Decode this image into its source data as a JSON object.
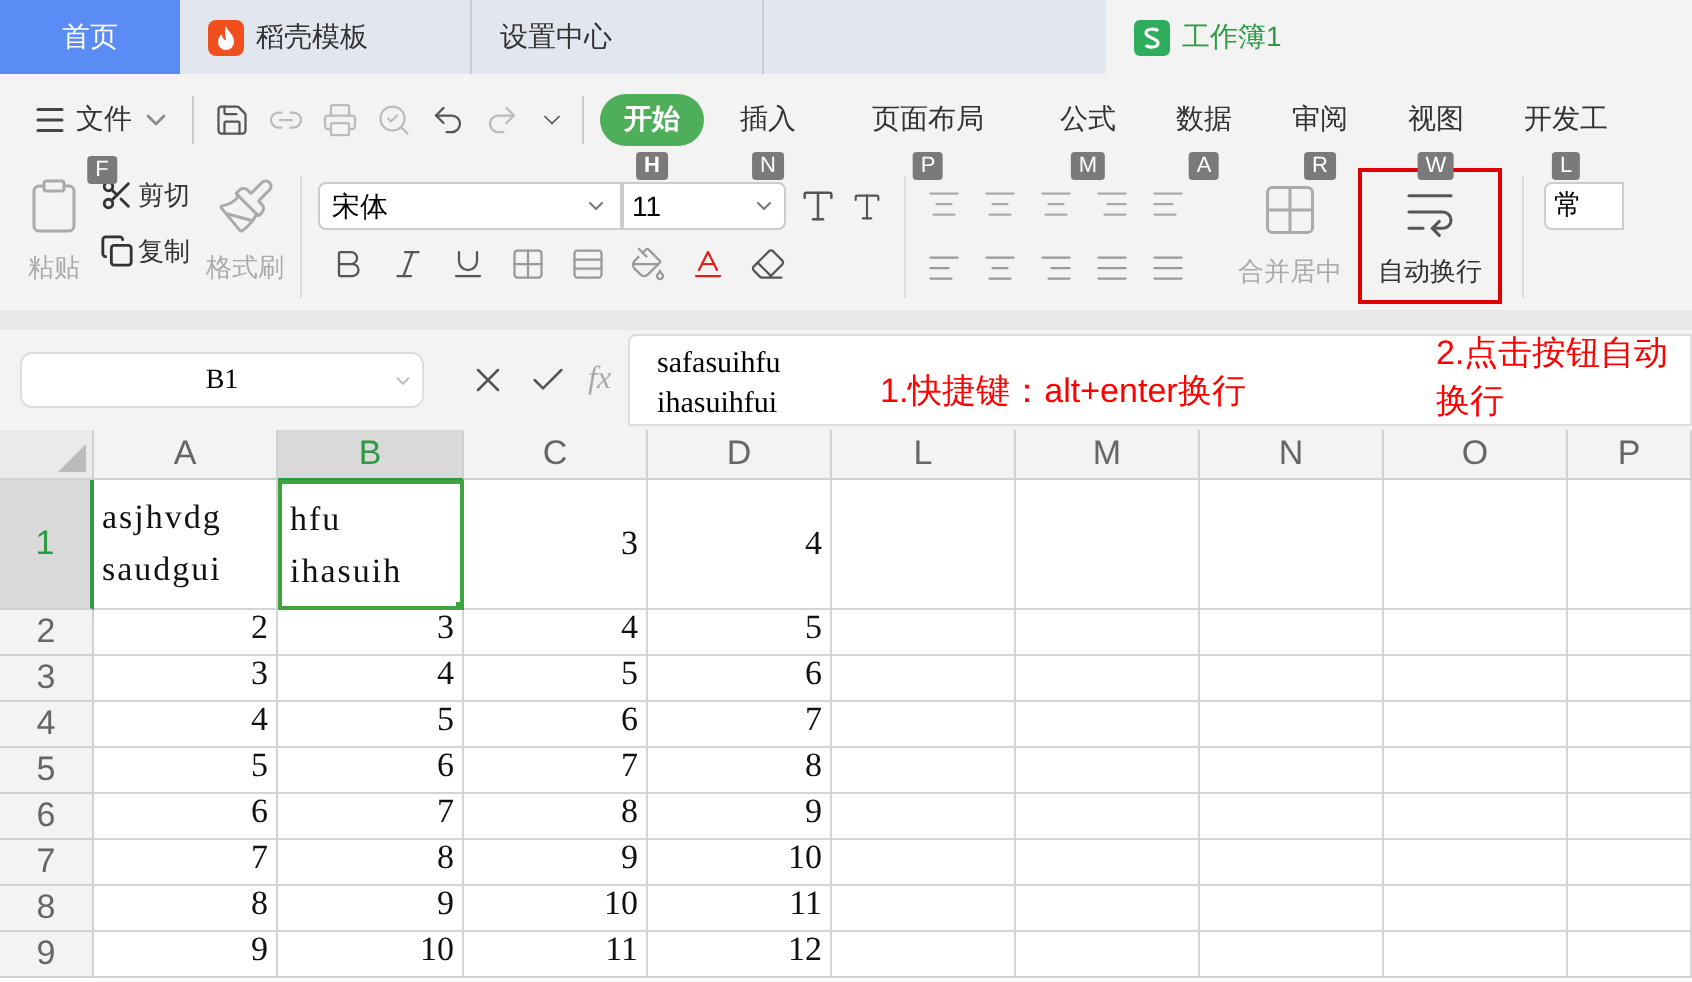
{
  "tabs": [
    {
      "label": "首页",
      "selected": false,
      "kind": "home"
    },
    {
      "label": "稻壳模板",
      "selected": false,
      "kind": "docer"
    },
    {
      "label": "设置中心",
      "selected": false,
      "kind": "plain"
    },
    {
      "label": "工作簿1",
      "selected": true,
      "kind": "sheet"
    }
  ],
  "menu": {
    "file": {
      "label": "文件",
      "keytip": "F"
    },
    "tabs": [
      {
        "label": "开始",
        "keytip": "H",
        "selected": true
      },
      {
        "label": "插入",
        "keytip": "N",
        "selected": false
      },
      {
        "label": "页面布局",
        "keytip": "P",
        "selected": false
      },
      {
        "label": "公式",
        "keytip": "M",
        "selected": false
      },
      {
        "label": "数据",
        "keytip": "A",
        "selected": false
      },
      {
        "label": "审阅",
        "keytip": "R",
        "selected": false
      },
      {
        "label": "视图",
        "keytip": "W",
        "selected": false
      },
      {
        "label": "开发工",
        "keytip": "L",
        "selected": false
      }
    ]
  },
  "ribbon": {
    "paste": {
      "label": "粘贴",
      "disabled": true
    },
    "cut": {
      "label": "剪切",
      "disabled": false
    },
    "copy": {
      "label": "复制",
      "disabled": false
    },
    "format_painter": {
      "label": "格式刷",
      "disabled": true
    },
    "font": {
      "value": "宋体"
    },
    "size": {
      "value": "11"
    },
    "merge": {
      "label": "合并居中",
      "disabled": true
    },
    "wrap": {
      "label": "自动换行",
      "highlighted": true
    },
    "number_format": {
      "value": "常"
    }
  },
  "formula_bar": {
    "name_box": "B1",
    "fx": "fx",
    "lines": [
      "safasuihfu",
      "ihasuihfui"
    ]
  },
  "annotations": [
    {
      "text": "1.快捷键：alt+enter换行"
    },
    {
      "text": "2.点击按钮自动换行"
    }
  ],
  "sheet": {
    "columns": [
      {
        "label": "A",
        "selected": false
      },
      {
        "label": "B",
        "selected": true
      },
      {
        "label": "C",
        "selected": false
      },
      {
        "label": "D",
        "selected": false
      },
      {
        "label": "L",
        "selected": false
      },
      {
        "label": "M",
        "selected": false
      },
      {
        "label": "N",
        "selected": false
      },
      {
        "label": "O",
        "selected": false
      },
      {
        "label": "P",
        "selected": false
      }
    ],
    "rows": [
      {
        "label": "1",
        "selected": true,
        "cells": [
          {
            "text": "asjhvdg\nsaudgui",
            "selected": false
          },
          {
            "text": "hfu\nihasuih",
            "selected": true
          },
          {
            "text": "3",
            "selected": false
          },
          {
            "text": "4",
            "selected": false
          }
        ]
      },
      {
        "label": "2",
        "selected": false,
        "cells": [
          {
            "text": "2",
            "selected": false
          },
          {
            "text": "3",
            "selected": false
          },
          {
            "text": "4",
            "selected": false
          },
          {
            "text": "5",
            "selected": false
          }
        ]
      },
      {
        "label": "3",
        "selected": false,
        "cells": [
          {
            "text": "3",
            "selected": false
          },
          {
            "text": "4",
            "selected": false
          },
          {
            "text": "5",
            "selected": false
          },
          {
            "text": "6",
            "selected": false
          }
        ]
      },
      {
        "label": "4",
        "selected": false,
        "cells": [
          {
            "text": "4",
            "selected": false
          },
          {
            "text": "5",
            "selected": false
          },
          {
            "text": "6",
            "selected": false
          },
          {
            "text": "7",
            "selected": false
          }
        ]
      },
      {
        "label": "5",
        "selected": false,
        "cells": [
          {
            "text": "5",
            "selected": false
          },
          {
            "text": "6",
            "selected": false
          },
          {
            "text": "7",
            "selected": false
          },
          {
            "text": "8",
            "selected": false
          }
        ]
      },
      {
        "label": "6",
        "selected": false,
        "cells": [
          {
            "text": "6",
            "selected": false
          },
          {
            "text": "7",
            "selected": false
          },
          {
            "text": "8",
            "selected": false
          },
          {
            "text": "9",
            "selected": false
          }
        ]
      },
      {
        "label": "7",
        "selected": false,
        "cells": [
          {
            "text": "7",
            "selected": false
          },
          {
            "text": "8",
            "selected": false
          },
          {
            "text": "9",
            "selected": false
          },
          {
            "text": "10",
            "selected": false
          }
        ]
      },
      {
        "label": "8",
        "selected": false,
        "cells": [
          {
            "text": "8",
            "selected": false
          },
          {
            "text": "9",
            "selected": false
          },
          {
            "text": "10",
            "selected": false
          },
          {
            "text": "11",
            "selected": false
          }
        ]
      },
      {
        "label": "9",
        "selected": false,
        "cells": [
          {
            "text": "9",
            "selected": false
          },
          {
            "text": "10",
            "selected": false
          },
          {
            "text": "11",
            "selected": false
          },
          {
            "text": "12",
            "selected": false
          }
        ]
      }
    ]
  }
}
